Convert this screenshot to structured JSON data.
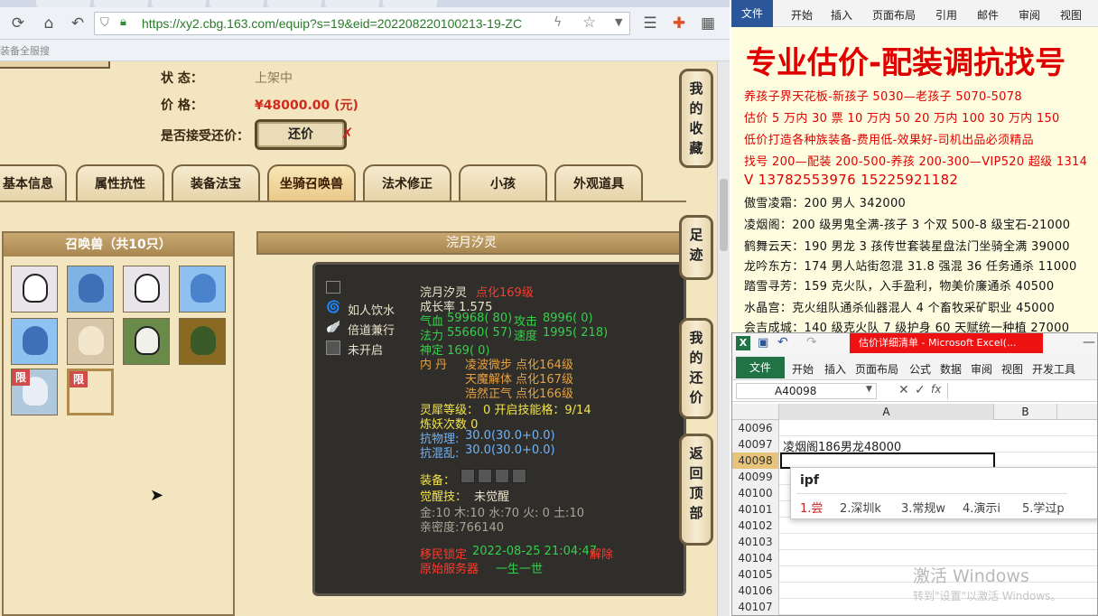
{
  "browser": {
    "url": "https://xy2.cbg.163.com/equip?s=19&eid=202208220100213-19-ZC",
    "bookmark": "装备全服搜"
  },
  "info": {
    "status_label": "状 态：",
    "status_value": "上架中",
    "price_label": "价 格：",
    "price_value": "¥48000.00 (元)",
    "bargain_label": "是否接受还价：",
    "bargain_button": "还价"
  },
  "tabs": [
    "基本信息",
    "属性抗性",
    "装备法宝",
    "坐骑召唤兽",
    "法术修正",
    "小孩",
    "外观道具"
  ],
  "summon": {
    "panel_title": "召唤兽（共10只）",
    "detail_title": "浣月汐灵",
    "limited_badge": "限"
  },
  "pet_detail": {
    "skills": [
      "如人饮水",
      "倍道兼行",
      "未开启"
    ],
    "name": "浣月汐灵",
    "dianhua": "点化169级",
    "growth": "成长率 1.575",
    "qixue_label": "气血",
    "qixue": "59968( 80)",
    "gongji_label": "攻击",
    "gongji": "8996( 0)",
    "fali_label": "法力",
    "fali": "55660( 57)",
    "sudu_label": "速度",
    "sudu": "1995( 218)",
    "shending": "神定 169( 0)",
    "neidan_label": "内  丹",
    "neidan1": "凌波微步 点化164级",
    "neidan2": "天魔解体 点化167级",
    "neidan3": "浩然正气 点化166级",
    "lingxi_label": "灵犀等级：",
    "lingxi_value": "0 开启技能格：9/14",
    "lianyao": "炼妖次数 0",
    "kangwuli_label": "抗物理:",
    "kangwuli": "30.0(30.0+0.0)",
    "kanghunluan_label": "抗混乱:",
    "kanghunluan": "30.0(30.0+0.0)",
    "zhuangbei_label": "装备：",
    "juexing_label": "觉醒技：",
    "juexing_value": "未觉醒",
    "elements": "金:10 木:10 水:70 火: 0 土:10",
    "qinmi": "亲密度:766140",
    "transfer_label": "移民锁定",
    "transfer_time": "2022-08-25 21:04:47",
    "transfer_suffix": "解除",
    "origin_label": "原始服务器",
    "origin_value": "一生一世"
  },
  "side_buttons": [
    "我的收藏",
    "足迹",
    "我的还价",
    "返回顶部"
  ],
  "word": {
    "menu": [
      "文件",
      "开始",
      "插入",
      "页面布局",
      "引用",
      "邮件",
      "审阅",
      "视图"
    ],
    "title": "专业估价-配装调抗找号",
    "lines": [
      "养孩子界天花板-新孩子 5030—老孩子 5070-5078",
      "估价 5 万内 30 票  10 万内 50  20 万内 100  30 万内 150",
      "低价打造各种族装备-费用低-效果好-司机出品必须精品",
      "找号 200—配装 200-500-养孩 200-300—VIP520 超级 1314",
      "V     13782553976     15225921182",
      "傲雪凌霜：200 男人 342000",
      "凌烟阁：200 级男鬼全满-孩子 3 个双 500-8 级宝石-21000",
      "鹤舞云天：190 男龙 3 孩传世套装星盘法门坐骑全满 39000",
      "龙吟东方：174 男人站街忽混 31.8 强混 36 任务通杀 11000",
      "踏雪寻芳：159 克火队，入手盈利，物美价廉通杀 40500",
      "水晶宫：克火组队通杀仙器混人 4 个畜牧采矿职业 45000",
      "会吉成城：140 级克火队 7 级护身 60 天赋统一种植 27000"
    ]
  },
  "excel": {
    "title": "估价详细清单 - Microsoft Excel(...",
    "menu": [
      "文件",
      "开始",
      "插入",
      "页面布局",
      "公式",
      "数据",
      "审阅",
      "视图",
      "开发工具"
    ],
    "namebox": "A40098",
    "fx": "fx",
    "col_a": "A",
    "col_b": "B",
    "rows": [
      {
        "num": "40096",
        "val": ""
      },
      {
        "num": "40097",
        "val": "凌烟阁186男龙48000"
      },
      {
        "num": "40098",
        "val": ""
      },
      {
        "num": "40099",
        "val": ""
      },
      {
        "num": "40100",
        "val": ""
      },
      {
        "num": "40101",
        "val": ""
      },
      {
        "num": "40102",
        "val": ""
      },
      {
        "num": "40103",
        "val": ""
      },
      {
        "num": "40104",
        "val": ""
      },
      {
        "num": "40105",
        "val": ""
      },
      {
        "num": "40106",
        "val": ""
      },
      {
        "num": "40107",
        "val": ""
      }
    ],
    "ime_input": "ipf",
    "ime_candidates": [
      "1.尝",
      "2.深圳k",
      "3.常规w",
      "4.演示i",
      "5.学过p"
    ]
  },
  "watermark": {
    "line1": "激活 Windows",
    "line2": "转到\"设置\"以激活 Windows。"
  }
}
